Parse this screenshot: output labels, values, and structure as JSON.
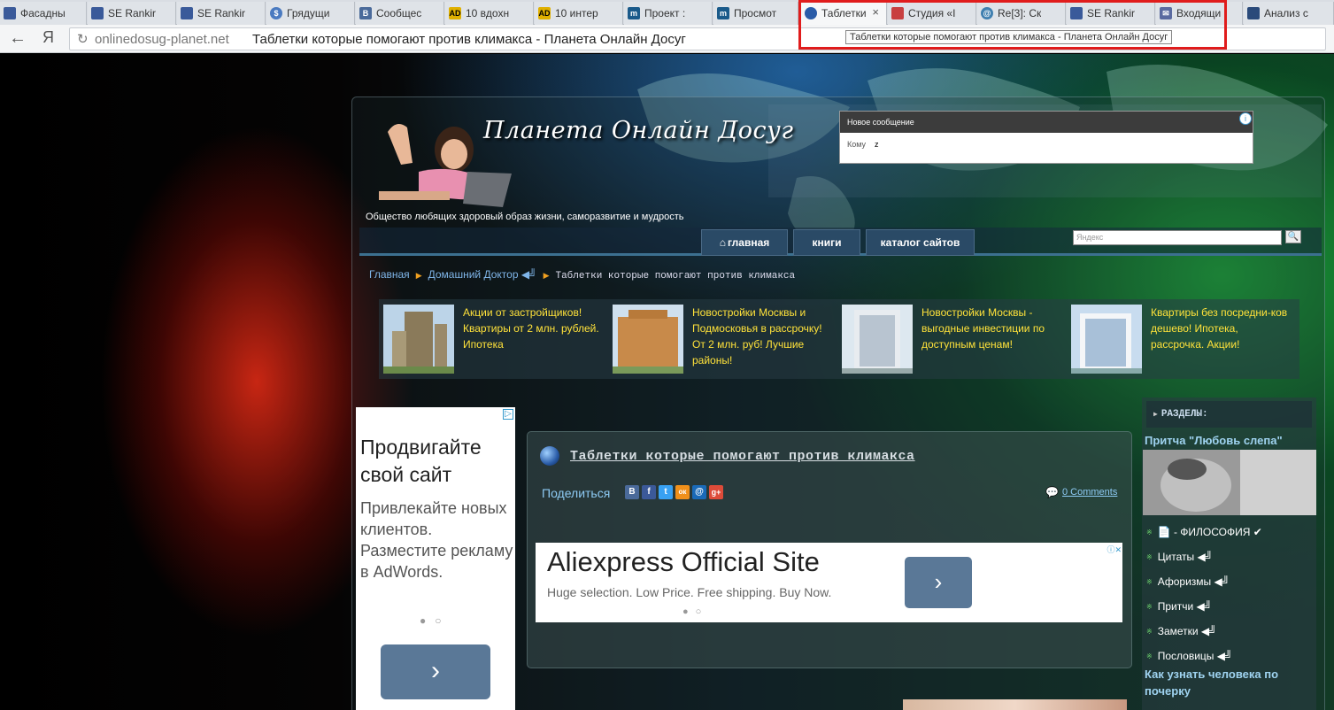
{
  "browser": {
    "tabs": [
      {
        "label": "Фасадны",
        "icon": "document-icon",
        "color": "#3a5a9a"
      },
      {
        "label": "SE Rankir",
        "icon": "bar-chart-icon",
        "color": "#3a5a9a"
      },
      {
        "label": "SE Rankir",
        "icon": "bar-chart-icon",
        "color": "#3a5a9a"
      },
      {
        "label": "Грядущи",
        "icon": "dollar-icon",
        "color": "#4a7ac0"
      },
      {
        "label": "Сообщес",
        "icon": "vk-icon",
        "color": "#4a6a9a"
      },
      {
        "label": "10 вдохн",
        "icon": "ad-icon",
        "color": "#e0b000"
      },
      {
        "label": "10 интер",
        "icon": "ad-icon",
        "color": "#e0b000"
      },
      {
        "label": "Проект :",
        "icon": "m-icon",
        "color": "#1a5a8a"
      },
      {
        "label": "Просмот",
        "icon": "m-icon",
        "color": "#1a5a8a"
      },
      {
        "label": "Таблетки",
        "icon": "globe-icon",
        "color": "#2a5ca8"
      },
      {
        "label": "Студия «I",
        "icon": "studio-icon",
        "color": "#c84040"
      },
      {
        "label": "Re[3]: Ск",
        "icon": "mail-at-icon",
        "color": "#4080b0"
      },
      {
        "label": "SE Rankir",
        "icon": "bar-chart-icon",
        "color": "#3a5a9a"
      },
      {
        "label": "Входящи",
        "icon": "envelope-icon",
        "color": "#5a6aa0"
      },
      {
        "label": "Анализ с",
        "icon": "analysis-icon",
        "color": "#2a4a7a"
      }
    ],
    "back_glyph": "←",
    "yandex_glyph": "Я",
    "url_domain": "onlinedosug-planet.net",
    "url_title": "Таблетки которые помогают против климакса - Планета Онлайн Досуг",
    "tooltip": "Таблетки которые помогают против климакса - Планета Онлайн Досуг"
  },
  "site": {
    "title": "Планета Онлайн Досуг",
    "tagline": "Общество любящих здоровый образ жизни, саморазвитие и мудрость",
    "message_widget": {
      "header": "Новое сообщение",
      "to_label": "Кому",
      "to_value": "z",
      "info_glyph": "i"
    },
    "nav": {
      "home": "главная",
      "books": "книги",
      "catalog": "каталог сайтов"
    },
    "search_placeholder": "Яндекс",
    "search_button_glyph": "🔍",
    "breadcrumb": {
      "home": "Главная",
      "section": "Домашний Доктор ◀╝",
      "current": "Таблетки которые помогают против климакса",
      "sep": "▶"
    },
    "ad_strip": [
      {
        "text": "Акции от застройщиков! Квартиры от 2 млн. рублей. Ипотека"
      },
      {
        "text": "Новостройки Москвы и Подмосковья в рассрочку! От 2 млн. руб! Лучшие районы!"
      },
      {
        "text": "Новостройки Москвы - выгодные инвестиции по доступным ценам!"
      },
      {
        "text": "Квартиры без посредни-ков дешево! Ипотека, рассрочка. Акции!"
      }
    ],
    "adwords": {
      "headline": "Продвигайте свой сайт",
      "body": "Привлекайте новых клиентов. Разместите рекламу в AdWords.",
      "dots": "●○",
      "button_glyph": "›",
      "adchoice_glyph": "▷"
    },
    "article": {
      "title": "Таблетки которые помогают против климакса",
      "share_label": "Поделиться",
      "share_buttons": [
        {
          "glyph": "В",
          "color": "#4a6a9a"
        },
        {
          "glyph": "f",
          "color": "#3b5998"
        },
        {
          "glyph": "t",
          "color": "#38a1f3"
        },
        {
          "glyph": "ок",
          "color": "#f0901a"
        },
        {
          "glyph": "@",
          "color": "#1a6ab8"
        },
        {
          "glyph": "g+",
          "color": "#dd4b39"
        }
      ],
      "comments_glyph": "💬",
      "comments": "0 Comments"
    },
    "ali_ad": {
      "title": "Aliexpress Official Site",
      "subtitle": "Huge selection. Low Price. Free shipping. Buy Now.",
      "button_glyph": "›",
      "dots": "●○",
      "info_glyph": "ⓘ✕"
    },
    "sidebar": {
      "heading": "РАЗДЕЛЫ:",
      "heading_arrow": "▶",
      "post1": "Притча \"Любовь слепа\"",
      "items": [
        "📄 - ФИЛОСОФИЯ ✔",
        "Цитаты ◀╝",
        "Афоризмы ◀╝",
        "Притчи ◀╝",
        "Заметки ◀╝",
        "Пословицы ◀╝"
      ],
      "bullet": "※",
      "post2": "Как узнать человека по почерку"
    }
  }
}
